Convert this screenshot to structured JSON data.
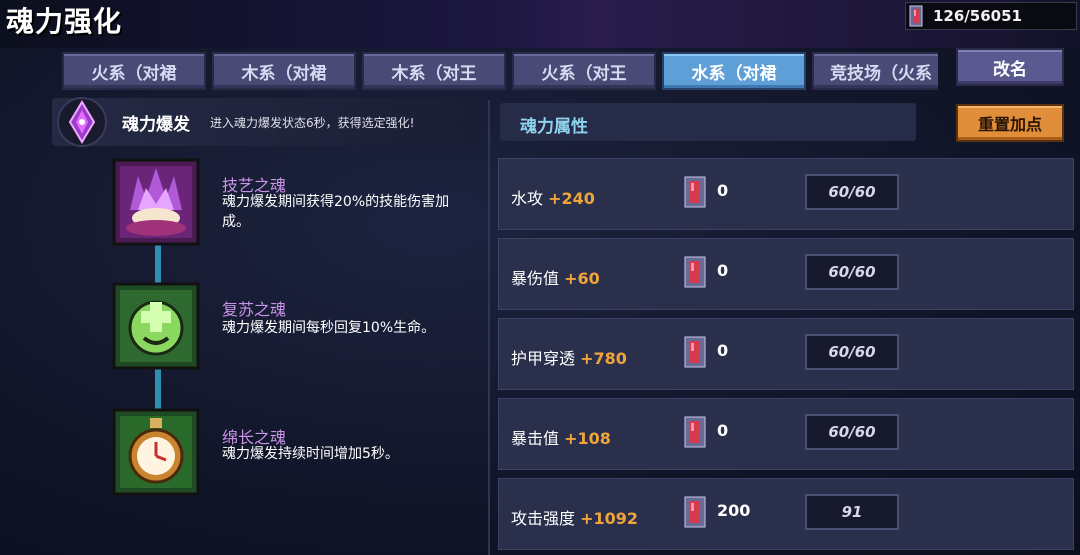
{
  "header": {
    "title": "魂力强化",
    "currency_value": "126/56051"
  },
  "tabs": [
    {
      "label": "火系（对裙"
    },
    {
      "label": "木系（对裙"
    },
    {
      "label": "木系（对王"
    },
    {
      "label": "火系（对王"
    },
    {
      "label": "水系（对裙",
      "active": true
    },
    {
      "label": "竞技场（火系"
    }
  ],
  "buttons": {
    "rename": "改名",
    "reset": "重置加点"
  },
  "burst": {
    "title": "魂力爆发",
    "description": "进入魂力爆发状态6秒，获得选定强化!"
  },
  "souls": [
    {
      "name": "技艺之魂",
      "description": "魂力爆发期间获得20%的技能伤害加成。",
      "icon": "purple-flame-icon"
    },
    {
      "name": "复苏之魂",
      "description": "魂力爆发期间每秒回复10%生命。",
      "icon": "green-heal-icon"
    },
    {
      "name": "绵长之魂",
      "description": "魂力爆发持续时间增加5秒。",
      "icon": "stopwatch-icon"
    }
  ],
  "attributes": {
    "header": "魂力属性",
    "rows": [
      {
        "name": "水攻",
        "bonus": "+240",
        "cost": "0",
        "level": "60/60"
      },
      {
        "name": "暴伤值",
        "bonus": "+60",
        "cost": "0",
        "level": "60/60"
      },
      {
        "name": "护甲穿透",
        "bonus": "+780",
        "cost": "0",
        "level": "60/60"
      },
      {
        "name": "暴击值",
        "bonus": "+108",
        "cost": "0",
        "level": "60/60"
      },
      {
        "name": "攻击强度",
        "bonus": "+1092",
        "cost": "200",
        "level": "91"
      }
    ]
  },
  "colors": {
    "accent_orange": "#f0a53c",
    "active_tab": "#5e9fd8",
    "soul_name": "#c994e8",
    "header_cyan": "#8fd4ee"
  }
}
